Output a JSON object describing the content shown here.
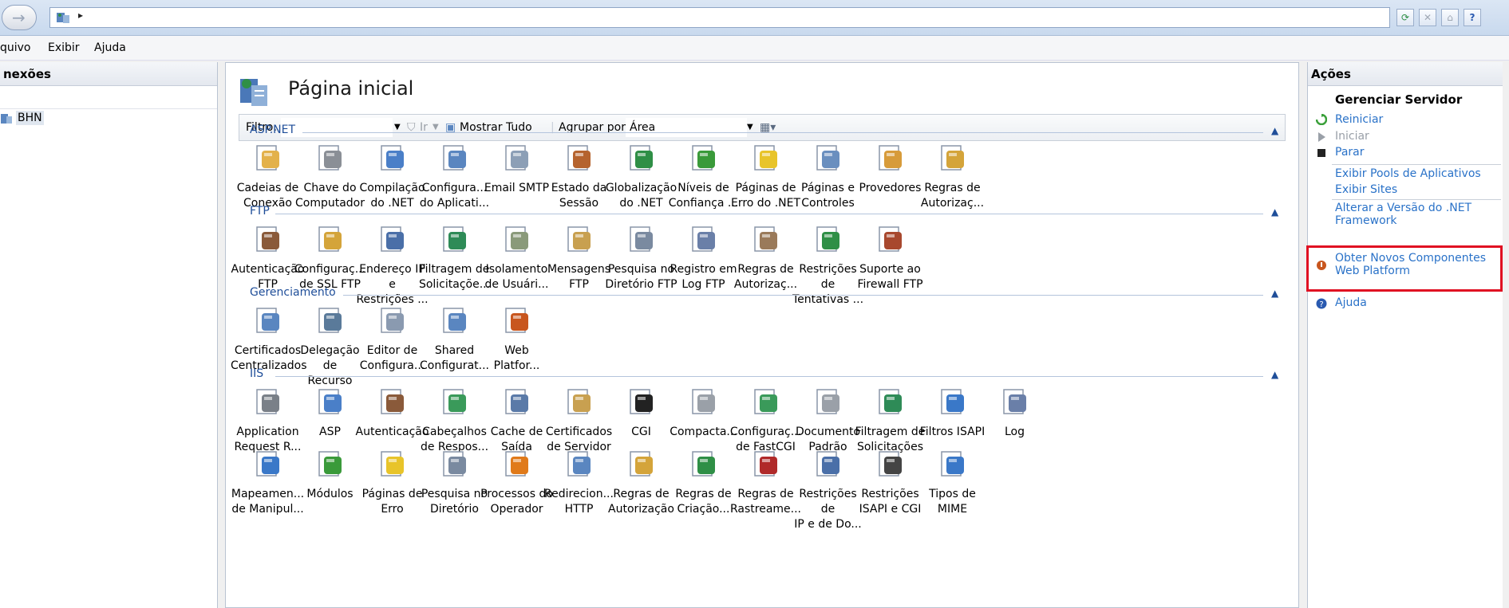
{
  "menu": [
    "quivo",
    "Exibir",
    "Ajuda"
  ],
  "connections": {
    "title": "nexões",
    "server_label": "BHN"
  },
  "page": {
    "title": "Página inicial"
  },
  "filterbar": {
    "filter_label": "Filtro:",
    "go_label": "Ir",
    "show_all_label": "Mostrar Tudo",
    "group_by_label": "Agrupar por:",
    "group_by_value": "Área"
  },
  "groups": [
    {
      "name": "ASP.NET",
      "items": [
        {
          "label": [
            "Cadeias de",
            "Conexão"
          ],
          "icon": "connection-strings-icon",
          "color": "#e3b14a"
        },
        {
          "label": [
            "Chave do",
            "Computador"
          ],
          "icon": "machine-key-icon",
          "color": "#8a8f96"
        },
        {
          "label": [
            "Compilação",
            "do .NET"
          ],
          "icon": "net-compilation-icon",
          "color": "#4a7fc8"
        },
        {
          "label": [
            "Configura...",
            "do Aplicati..."
          ],
          "icon": "app-settings-icon",
          "color": "#5a86c0"
        },
        {
          "label": [
            "Email SMTP",
            ""
          ],
          "icon": "smtp-email-icon",
          "color": "#8c9fb6"
        },
        {
          "label": [
            "Estado da",
            "Sessão"
          ],
          "icon": "session-state-icon",
          "color": "#b5632e"
        },
        {
          "label": [
            "Globalização",
            "do .NET"
          ],
          "icon": "globalization-icon",
          "color": "#2f8f46"
        },
        {
          "label": [
            "Níveis de",
            "Confiança ..."
          ],
          "icon": "trust-levels-icon",
          "color": "#3a9a3a"
        },
        {
          "label": [
            "Páginas de",
            "Erro do .NET"
          ],
          "icon": "error-pages-net-icon",
          "color": "#e8c42a"
        },
        {
          "label": [
            "Páginas e",
            "Controles"
          ],
          "icon": "pages-controls-icon",
          "color": "#6a8fbf"
        },
        {
          "label": [
            "Provedores",
            ""
          ],
          "icon": "providers-icon",
          "color": "#d79b3a"
        },
        {
          "label": [
            "Regras de",
            "Autorizaç..."
          ],
          "icon": "authorization-rules-icon",
          "color": "#d4a43a"
        }
      ]
    },
    {
      "name": "FTP",
      "items": [
        {
          "label": [
            "Autenticação",
            "FTP"
          ],
          "icon": "ftp-authentication-icon",
          "color": "#8a5a3a"
        },
        {
          "label": [
            "Configuraç...",
            "de SSL FTP"
          ],
          "icon": "ftp-ssl-icon",
          "color": "#d4a43a"
        },
        {
          "label": [
            "Endereço IP e",
            "Restrições ..."
          ],
          "icon": "ftp-ip-restrictions-icon",
          "color": "#4a6fa8"
        },
        {
          "label": [
            "Filtragem de",
            "Solicitaçõe..."
          ],
          "icon": "ftp-request-filtering-icon",
          "color": "#2e8b57"
        },
        {
          "label": [
            "Isolamento",
            "de Usuári..."
          ],
          "icon": "ftp-user-isolation-icon",
          "color": "#8a9a7a"
        },
        {
          "label": [
            "Mensagens",
            "FTP"
          ],
          "icon": "ftp-messages-icon",
          "color": "#c8a050"
        },
        {
          "label": [
            "Pesquisa no",
            "Diretório FTP"
          ],
          "icon": "ftp-directory-browsing-icon",
          "color": "#7a8aa0"
        },
        {
          "label": [
            "Registro em",
            "Log FTP"
          ],
          "icon": "ftp-logging-icon",
          "color": "#6a7fa8"
        },
        {
          "label": [
            "Regras de",
            "Autorizaç..."
          ],
          "icon": "ftp-authorization-rules-icon",
          "color": "#9a7a5a"
        },
        {
          "label": [
            "Restrições de",
            "Tentativas ..."
          ],
          "icon": "ftp-logon-attempts-icon",
          "color": "#2f8f46"
        },
        {
          "label": [
            "Suporte ao",
            "Firewall FTP"
          ],
          "icon": "ftp-firewall-icon",
          "color": "#a8482e"
        }
      ]
    },
    {
      "name": "Gerenciamento",
      "items": [
        {
          "label": [
            "Certificados",
            "Centralizados"
          ],
          "icon": "centralized-certificates-icon",
          "color": "#5a86c0"
        },
        {
          "label": [
            "Delegação de",
            "Recurso"
          ],
          "icon": "feature-delegation-icon",
          "color": "#5a7a9a"
        },
        {
          "label": [
            "Editor de",
            "Configura..."
          ],
          "icon": "configuration-editor-icon",
          "color": "#8a9ab0"
        },
        {
          "label": [
            "Shared",
            "Configurat..."
          ],
          "icon": "shared-configuration-icon",
          "color": "#5a86c0"
        },
        {
          "label": [
            "Web",
            "Platfor..."
          ],
          "icon": "web-platform-icon",
          "color": "#c8561e"
        }
      ]
    },
    {
      "name": "IIS",
      "items": [
        {
          "label": [
            "Application",
            "Request R..."
          ],
          "icon": "arr-icon",
          "color": "#7a8088"
        },
        {
          "label": [
            "ASP",
            ""
          ],
          "icon": "asp-icon",
          "color": "#4a7fc8"
        },
        {
          "label": [
            "Autenticação",
            ""
          ],
          "icon": "authentication-icon",
          "color": "#8a5a3a"
        },
        {
          "label": [
            "Cabeçalhos",
            "de Respos..."
          ],
          "icon": "response-headers-icon",
          "color": "#3a9a5a"
        },
        {
          "label": [
            "Cache de",
            "Saída"
          ],
          "icon": "output-caching-icon",
          "color": "#5a7aa8"
        },
        {
          "label": [
            "Certificados",
            "de Servidor"
          ],
          "icon": "server-certificates-icon",
          "color": "#c8a050"
        },
        {
          "label": [
            "CGI",
            ""
          ],
          "icon": "cgi-icon",
          "color": "#222222"
        },
        {
          "label": [
            "Compacta...",
            ""
          ],
          "icon": "compression-icon",
          "color": "#9aa0a8"
        },
        {
          "label": [
            "Configuraç...",
            "de FastCGI"
          ],
          "icon": "fastcgi-icon",
          "color": "#3a9a5a"
        },
        {
          "label": [
            "Documento",
            "Padrão"
          ],
          "icon": "default-document-icon",
          "color": "#9aa0a8"
        },
        {
          "label": [
            "Filtragem de",
            "Solicitações"
          ],
          "icon": "request-filtering-icon",
          "color": "#2e8b57"
        },
        {
          "label": [
            "Filtros ISAPI",
            ""
          ],
          "icon": "isapi-filters-icon",
          "color": "#3a78c8"
        },
        {
          "label": [
            "Log",
            ""
          ],
          "icon": "logging-icon",
          "color": "#6a7fa8"
        },
        {
          "label": [
            "Mapeamen...",
            "de Manipul..."
          ],
          "icon": "handler-mappings-icon",
          "color": "#3a78c8"
        },
        {
          "label": [
            "Módulos",
            ""
          ],
          "icon": "modules-icon",
          "color": "#3a9a3a"
        },
        {
          "label": [
            "Páginas de",
            "Erro"
          ],
          "icon": "error-pages-icon",
          "color": "#e8c42a"
        },
        {
          "label": [
            "Pesquisa no",
            "Diretório"
          ],
          "icon": "directory-browsing-icon",
          "color": "#7a8aa0"
        },
        {
          "label": [
            "Processos do",
            "Operador"
          ],
          "icon": "worker-processes-icon",
          "color": "#e07a1a"
        },
        {
          "label": [
            "Redirecion...",
            "HTTP"
          ],
          "icon": "http-redirect-icon",
          "color": "#5a86c0"
        },
        {
          "label": [
            "Regras de",
            "Autorização"
          ],
          "icon": "authorization-rules-iis-icon",
          "color": "#d4a43a"
        },
        {
          "label": [
            "Regras de",
            "Criação..."
          ],
          "icon": "failed-request-rules-icon",
          "color": "#2f8f46"
        },
        {
          "label": [
            "Regras de",
            "Rastreame..."
          ],
          "icon": "failed-request-tracing-icon",
          "color": "#b02a2a"
        },
        {
          "label": [
            "Restrições de",
            "IP e de Do..."
          ],
          "icon": "ip-domain-restrictions-icon",
          "color": "#4a6fa8"
        },
        {
          "label": [
            "Restrições",
            "ISAPI e CGI"
          ],
          "icon": "isapi-cgi-restrictions-icon",
          "color": "#444444"
        },
        {
          "label": [
            "Tipos de",
            "MIME"
          ],
          "icon": "mime-types-icon",
          "color": "#3a78c8"
        }
      ]
    }
  ],
  "actions": {
    "title": "Ações",
    "heading": "Gerenciar Servidor",
    "restart": "Reiniciar",
    "start": "Iniciar",
    "stop": "Parar",
    "view_pools": "Exibir Pools de Aplicativos",
    "view_sites": "Exibir Sites",
    "change_net_1": "Alterar a Versão do .NET",
    "change_net_2": "Framework",
    "get_components_1": "Obter Novos Componentes",
    "get_components_2": "Web Platform",
    "help": "Ajuda"
  },
  "colors": {
    "link": "#2a72c8",
    "group_header": "#1f4e99",
    "highlight_box": "#e01022"
  }
}
